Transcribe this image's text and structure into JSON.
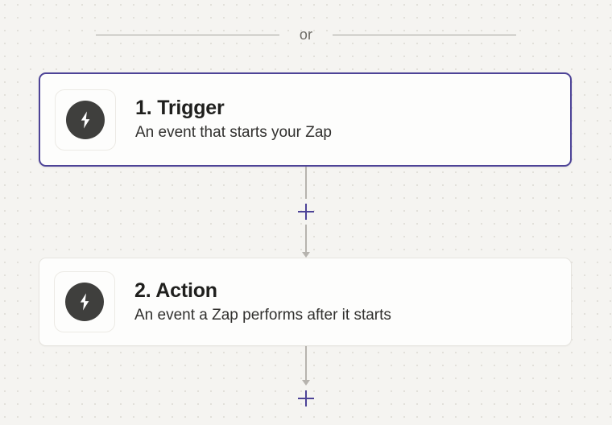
{
  "canvas": {
    "background_color": "#f5f4f1",
    "dot_color": "#e2e0da",
    "accent_color": "#4d4397",
    "connector_color": "#b6b3ae"
  },
  "divider": {
    "label": "or"
  },
  "steps": [
    {
      "title": "1. Trigger",
      "subtitle": "An event that starts your Zap",
      "icon": "bolt-icon",
      "selected": true
    },
    {
      "title": "2. Action",
      "subtitle": "An event a Zap performs after it starts",
      "icon": "bolt-icon",
      "selected": false
    }
  ],
  "connectors": {
    "add_step_label": "+"
  }
}
